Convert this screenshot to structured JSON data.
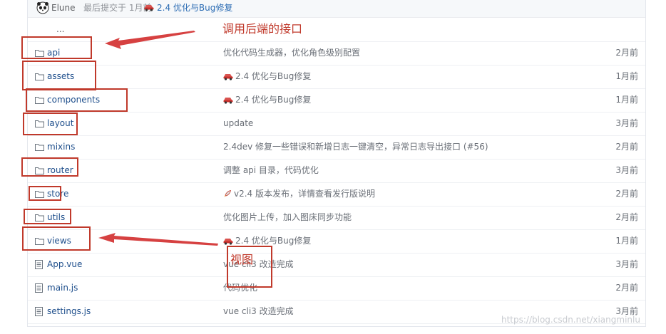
{
  "commit": {
    "author": "Elune",
    "meta": "最后提交于 1月前",
    "message": "2.4 优化与Bug修复"
  },
  "parent_label": "...",
  "rows": [
    {
      "name": "api",
      "kind": "folder",
      "desc": "优化代码生成器，优化角色级别配置",
      "desc_icon": "",
      "date": "2月前"
    },
    {
      "name": "assets",
      "kind": "folder",
      "desc": "2.4 优化与Bug修复",
      "desc_icon": "car",
      "date": "1月前"
    },
    {
      "name": "components",
      "kind": "folder",
      "desc": "2.4 优化与Bug修复",
      "desc_icon": "car",
      "date": "1月前"
    },
    {
      "name": "layout",
      "kind": "folder",
      "desc": "update",
      "desc_icon": "",
      "date": "3月前"
    },
    {
      "name": "mixins",
      "kind": "folder",
      "desc": "2.4dev 修复一些错误和新增日志一键清空，异常日志导出接口 (#56)",
      "desc_icon": "",
      "date": "2月前"
    },
    {
      "name": "router",
      "kind": "folder",
      "desc": "调整 api 目录，代码优化",
      "desc_icon": "",
      "date": "3月前"
    },
    {
      "name": "store",
      "kind": "folder",
      "desc": "v2.4 版本发布，详情查看发行版说明",
      "desc_icon": "rocket",
      "date": "2月前"
    },
    {
      "name": "utils",
      "kind": "folder",
      "desc": "优化图片上传，加入图床同步功能",
      "desc_icon": "",
      "date": "2月前"
    },
    {
      "name": "views",
      "kind": "folder",
      "desc": "2.4 优化与Bug修复",
      "desc_icon": "car",
      "date": "1月前"
    },
    {
      "name": "App.vue",
      "kind": "file",
      "desc": "vue cli3 改造完成",
      "desc_icon": "",
      "date": "3月前"
    },
    {
      "name": "main.js",
      "kind": "file",
      "desc": "代码优化",
      "desc_icon": "",
      "date": "2月前"
    },
    {
      "name": "settings.js",
      "kind": "file",
      "desc": "vue cli3 改造完成",
      "desc_icon": "",
      "date": "3月前"
    }
  ],
  "annotations": {
    "api_note": "调用后端的接口",
    "views_note": "视图"
  },
  "watermark": "https://blog.csdn.net/xiangminlu",
  "colors": {
    "annotation": "#c0392b",
    "link": "#1f4f8c"
  }
}
